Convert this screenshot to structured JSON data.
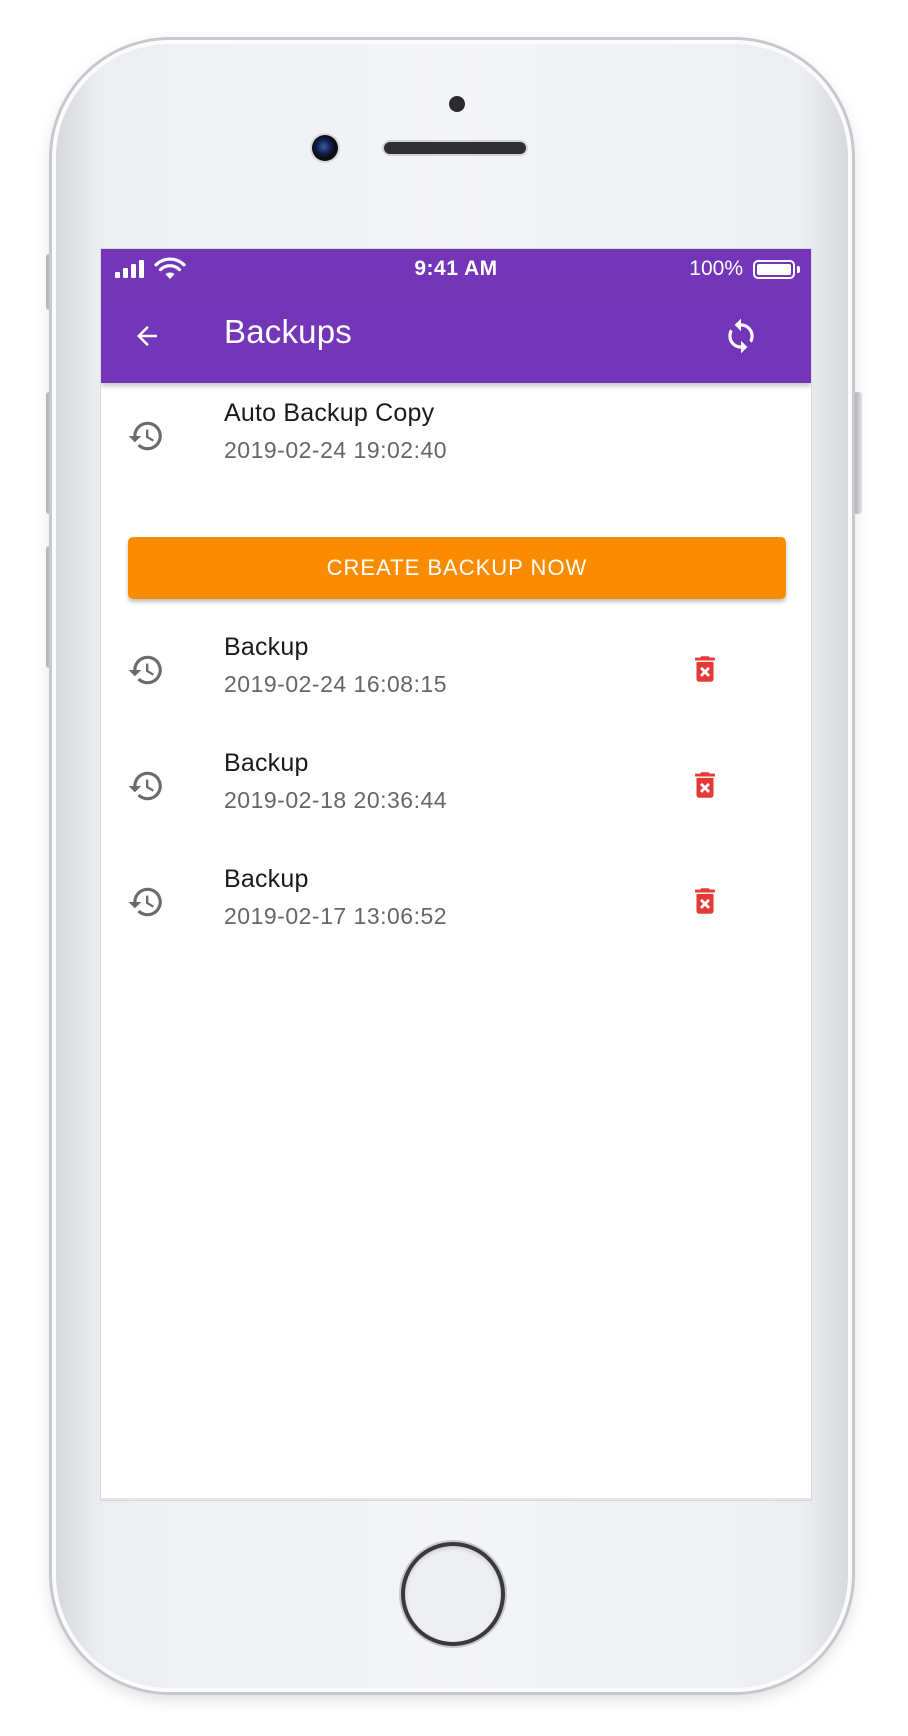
{
  "status_bar": {
    "time": "9:41 AM",
    "battery": "100%"
  },
  "app_bar": {
    "title": "Backups",
    "back_icon": "arrow-left-icon",
    "refresh_icon": "refresh-icon"
  },
  "auto_backup": {
    "title": "Auto Backup Copy",
    "timestamp": "2019-02-24 19:02:40",
    "icon": "history-icon"
  },
  "create_button": {
    "label": "CREATE BACKUP NOW"
  },
  "backups": [
    {
      "title": "Backup",
      "timestamp": "2019-02-24 16:08:15"
    },
    {
      "title": "Backup",
      "timestamp": "2019-02-18 20:36:44"
    },
    {
      "title": "Backup",
      "timestamp": "2019-02-17 13:06:52"
    }
  ],
  "colors": {
    "primary": "#7436b8",
    "accent": "#fb8c00",
    "delete": "#e53935",
    "icon_gray": "#6b6b6b"
  }
}
